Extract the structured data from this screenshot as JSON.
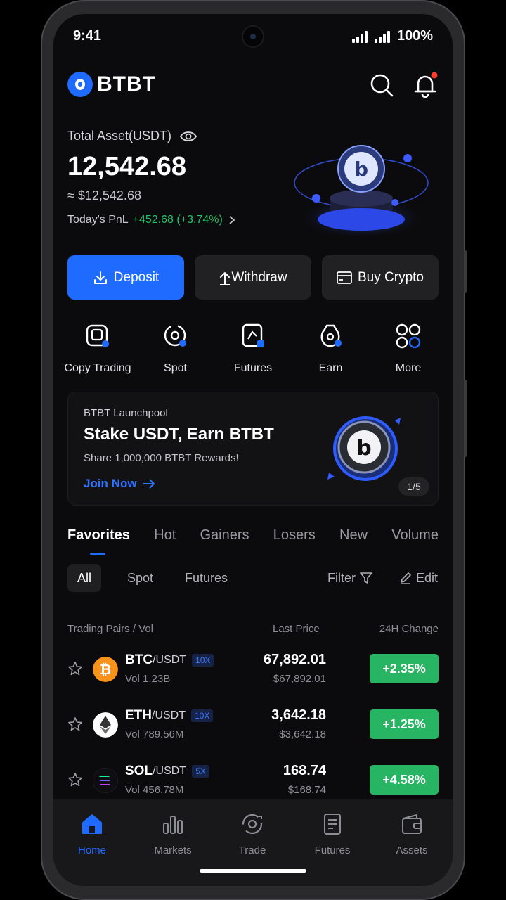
{
  "status": {
    "time": "9:41",
    "battery": "100%"
  },
  "header": {
    "brand": "BTBT"
  },
  "asset": {
    "label": "Total Asset(USDT)",
    "value": "12,542.68",
    "approx": "≈ $12,542.68",
    "pnl_label": "Today's PnL",
    "pnl_value": "+452.68 (+3.74%)"
  },
  "actions": {
    "deposit": "Deposit",
    "withdraw": "Withdraw",
    "buy": "Buy Crypto"
  },
  "shortcuts": [
    {
      "label": "Copy Trading",
      "icon": "copy-trading-icon"
    },
    {
      "label": "Spot",
      "icon": "spot-icon"
    },
    {
      "label": "Futures",
      "icon": "futures-icon"
    },
    {
      "label": "Earn",
      "icon": "earn-icon"
    },
    {
      "label": "More",
      "icon": "more-icon"
    }
  ],
  "banner": {
    "subtitle": "BTBT Launchpool",
    "title": "Stake USDT, Earn BTBT",
    "desc": "Share 1,000,000 BTBT Rewards!",
    "cta": "Join Now",
    "page": "1/5"
  },
  "market_tabs": [
    "Favorites",
    "Hot",
    "Gainers",
    "Losers",
    "New",
    "Volume"
  ],
  "sub_tabs": {
    "all": "All",
    "spot": "Spot",
    "futures": "Futures",
    "filter": "Filter",
    "edit": "Edit"
  },
  "columns": {
    "pair": "Trading Pairs / Vol",
    "price": "Last Price",
    "change": "24H Change"
  },
  "rows": [
    {
      "base": "BTC",
      "quote": "/USDT",
      "leverage": "10X",
      "vol": "Vol 1.23B",
      "price": "67,892.01",
      "fiat": "$67,892.01",
      "change": "+2.35%",
      "coin_color": "#f7931a"
    },
    {
      "base": "ETH",
      "quote": "/USDT",
      "leverage": "10X",
      "vol": "Vol 789.56M",
      "price": "3,642.18",
      "fiat": "$3,642.18",
      "change": "+1.25%",
      "coin_color": "#ffffff"
    },
    {
      "base": "SOL",
      "quote": "/USDT",
      "leverage": "5X",
      "vol": "Vol 456.78M",
      "price": "168.74",
      "fiat": "$168.74",
      "change": "+4.58%",
      "coin_color": "#0d0d12"
    }
  ],
  "nav": [
    "Home",
    "Markets",
    "Trade",
    "Futures",
    "Assets"
  ],
  "colors": {
    "accent": "#1f6bff",
    "gain": "#27b463",
    "background": "#0b0b0d"
  }
}
